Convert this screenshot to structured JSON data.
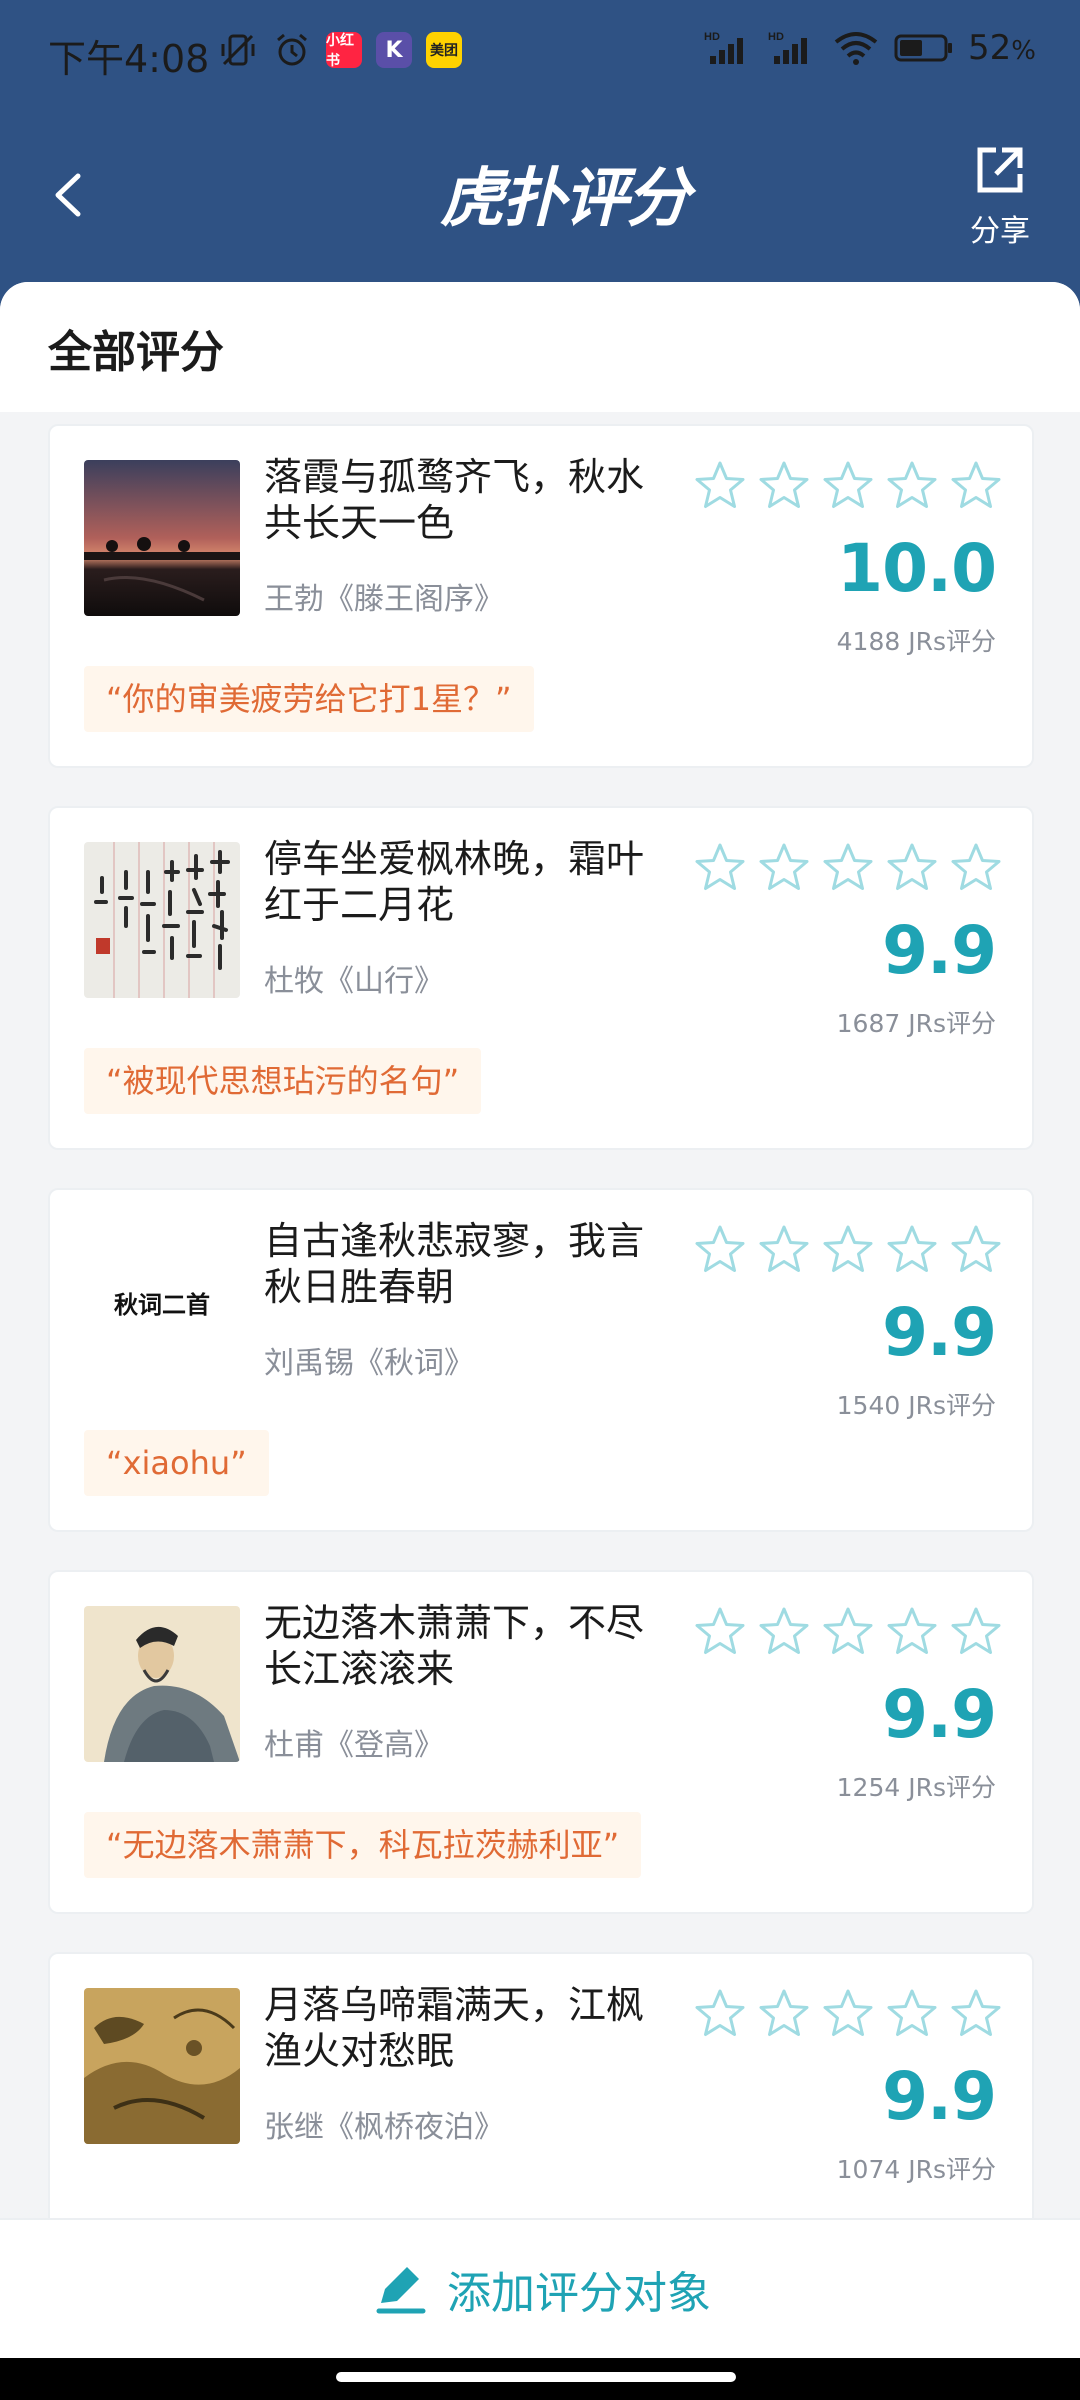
{
  "status_bar": {
    "time": "下午4:08",
    "apps": [
      "小红书",
      "K",
      "美团"
    ],
    "hd_label": "HD",
    "battery": "52",
    "battery_unit": "%"
  },
  "nav": {
    "logo": "虎扑评分",
    "share_label": "分享"
  },
  "section": {
    "title": "全部评分"
  },
  "items": [
    {
      "quote": "落霞与孤鹜齐飞，秋水共长天一色",
      "author": "王勃《滕王阁序》",
      "score": "10.0",
      "count": "4188 JRs评分",
      "comment": "“你的审美疲劳给它打1星？”"
    },
    {
      "quote": "停车坐爱枫林晚，霜叶红于二月花",
      "author": "杜牧《山行》",
      "score": "9.9",
      "count": "1687 JRs评分",
      "comment": "“被现代思想玷污的名句”"
    },
    {
      "quote": "自古逢秋悲寂寥，我言秋日胜春朝",
      "author": "刘禹锡《秋词》",
      "score": "9.9",
      "count": "1540 JRs评分",
      "comment": "“xiaohu”",
      "thumb_text": "秋词二首"
    },
    {
      "quote": "无边落木萧萧下，不尽长江滚滚来",
      "author": "杜甫《登高》",
      "score": "9.9",
      "count": "1254 JRs评分",
      "comment": "“无边落木萧萧下，科瓦拉茨赫利亚”"
    },
    {
      "quote": "月落乌啼霜满天，江枫渔火对愁眠",
      "author": "张继《枫桥夜泊》",
      "score": "9.9",
      "count": "1074 JRs评分",
      "comment": ""
    }
  ],
  "bottom": {
    "add_label": "添加评分对象"
  },
  "colors": {
    "header": "#2f5284",
    "accent": "#1fa3b4",
    "comment_text": "#e06a35",
    "comment_bg": "#fff6ec"
  }
}
